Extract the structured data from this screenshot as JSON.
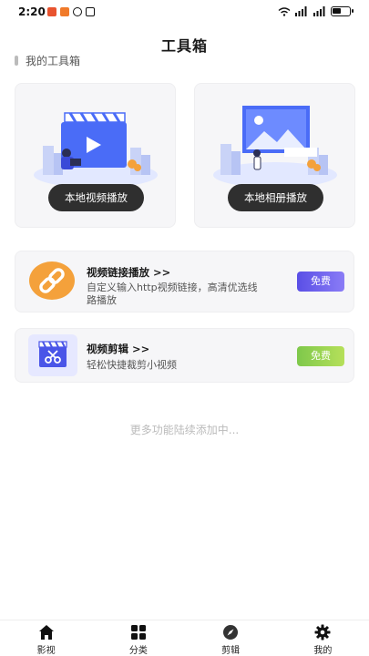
{
  "status_bar": {
    "time": "2:20",
    "battery_icon": "battery-icon",
    "signal_icon": "signal-icon",
    "wifi_icon": "wifi-icon"
  },
  "page": {
    "title": "工具箱"
  },
  "section": {
    "title": "我的工具箱"
  },
  "tools": [
    {
      "label": "本地视频播放",
      "icon": "video-illustration"
    },
    {
      "label": "本地相册播放",
      "icon": "photo-illustration"
    }
  ],
  "features": [
    {
      "title": "视频链接播放 >>",
      "desc": "自定义输入http视频链接，高清优选线路播放",
      "badge": "免费",
      "icon": "link-icon",
      "badge_color": "#6c5ff0"
    },
    {
      "title": "视频剪辑 >>",
      "desc": "轻松快捷裁剪小视频",
      "badge": "免费",
      "icon": "video-edit-icon",
      "badge_color": "#94d24f"
    }
  ],
  "more_text": "更多功能陆续添加中...",
  "tabbar": [
    {
      "label": "影视",
      "icon": "home-icon"
    },
    {
      "label": "分类",
      "icon": "grid-icon"
    },
    {
      "label": "剪辑",
      "icon": "compass-icon"
    },
    {
      "label": "我的",
      "icon": "gear-icon"
    }
  ],
  "colors": {
    "card_bg": "#f6f6f8",
    "button_dark": "#2f2f2f",
    "accent_orange": "#f4a13b",
    "accent_purple": "#5a4fe6",
    "accent_green": "#94d24f",
    "illus_blue": "#4a6cf7"
  }
}
